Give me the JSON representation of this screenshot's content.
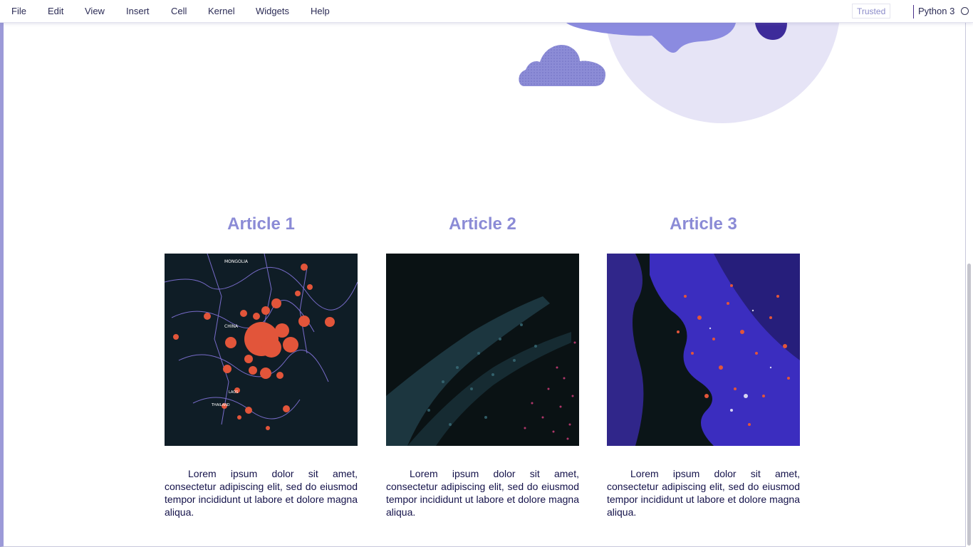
{
  "menu": {
    "items": [
      "File",
      "Edit",
      "View",
      "Insert",
      "Cell",
      "Kernel",
      "Widgets",
      "Help"
    ],
    "trusted_label": "Trusted",
    "kernel_name": "Python 3"
  },
  "colors": {
    "accent": "#8b8bd6",
    "frame_left": "#9c9ad8",
    "body_text": "#14124a",
    "map_marker": "#e2553a",
    "moon": "#e6e4f6"
  },
  "articles": [
    {
      "title": "Article 1",
      "image": "world-map-hotspots-image",
      "map_labels": [
        "MONGOLIA",
        "CHINA",
        "LAOS",
        "THAILAND"
      ],
      "text": "Lorem ipsum dolor sit amet, consectetur adipiscing elit, sed do eiusmod tempor incididunt ut labore et dolore magna aliqua."
    },
    {
      "title": "Article 2",
      "image": "particle-wave-image",
      "text": "Lorem ipsum dolor sit amet, consectetur adipiscing elit, sed do eiusmod tempor incididunt ut labore et dolore magna aliqua."
    },
    {
      "title": "Article 3",
      "image": "neon-face-image",
      "text": "Lorem ipsum dolor sit amet, consectetur adipiscing elit, sed do eiusmod tempor incididunt ut labore et dolore magna aliqua."
    }
  ]
}
